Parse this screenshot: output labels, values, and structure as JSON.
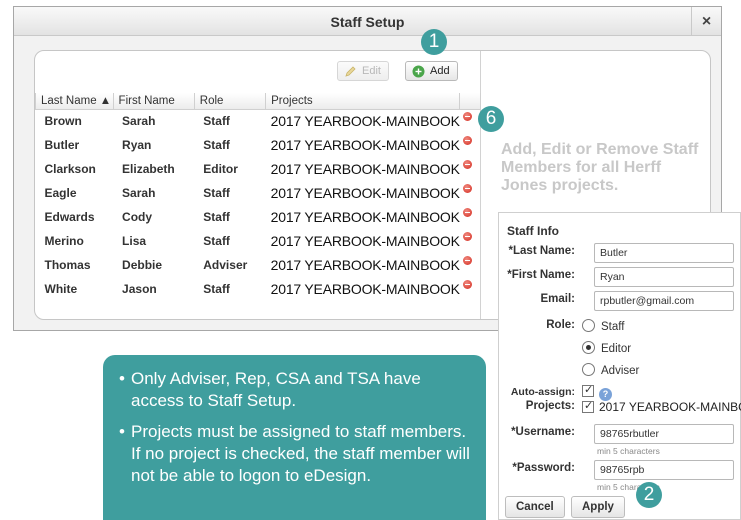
{
  "dialog": {
    "title": "Staff Setup",
    "close_label": "×"
  },
  "toolbar": {
    "edit_label": "Edit",
    "add_label": "Add"
  },
  "table": {
    "columns": [
      "Last Name ▲",
      "First Name",
      "Role",
      "Projects"
    ],
    "rows": [
      {
        "last": "Brown",
        "first": "Sarah",
        "role": "Staff",
        "project": "2017 YEARBOOK-MAINBOOK"
      },
      {
        "last": "Butler",
        "first": "Ryan",
        "role": "Staff",
        "project": "2017 YEARBOOK-MAINBOOK"
      },
      {
        "last": "Clarkson",
        "first": "Elizabeth",
        "role": "Editor",
        "project": "2017 YEARBOOK-MAINBOOK"
      },
      {
        "last": "Eagle",
        "first": "Sarah",
        "role": "Staff",
        "project": "2017 YEARBOOK-MAINBOOK"
      },
      {
        "last": "Edwards",
        "first": "Cody",
        "role": "Staff",
        "project": "2017 YEARBOOK-MAINBOOK"
      },
      {
        "last": "Merino",
        "first": "Lisa",
        "role": "Staff",
        "project": "2017 YEARBOOK-MAINBOOK"
      },
      {
        "last": "Thomas",
        "first": "Debbie",
        "role": "Adviser",
        "project": "2017 YEARBOOK-MAINBOOK"
      },
      {
        "last": "White",
        "first": "Jason",
        "role": "Staff",
        "project": "2017 YEARBOOK-MAINBOOK"
      }
    ]
  },
  "promo_text": "Add, Edit or Remove Staff Members for all Herff Jones projects.",
  "badges": {
    "b1": "1",
    "b6": "6",
    "b2": "2"
  },
  "staff_info": {
    "header": "Staff Info",
    "last_name_label": "*Last Name:",
    "last_name_value": "Butler",
    "first_name_label": "*First Name:",
    "first_name_value": "Ryan",
    "email_label": "Email:",
    "email_value": "rpbutler@gmail.com",
    "role_label": "Role:",
    "roles": [
      "Staff",
      "Editor",
      "Adviser"
    ],
    "selected_role": "Editor",
    "auto_assign_label": "Auto-assign:",
    "projects_label": "Projects:",
    "project_value": "2017 YEARBOOK-MAINBO...",
    "username_label": "*Username:",
    "username_value": "98765rbutler",
    "username_hint": "min 5 characters",
    "password_label": "*Password:",
    "password_value": "98765rpb",
    "password_hint": "min 5 characters",
    "cancel_label": "Cancel",
    "apply_label": "Apply"
  },
  "notes": [
    "Only Adviser, Rep, CSA and TSA have access to Staff Setup.",
    "Projects must be assigned to staff members. If no project is checked, the staff member will not be able to logon to eDesign."
  ]
}
